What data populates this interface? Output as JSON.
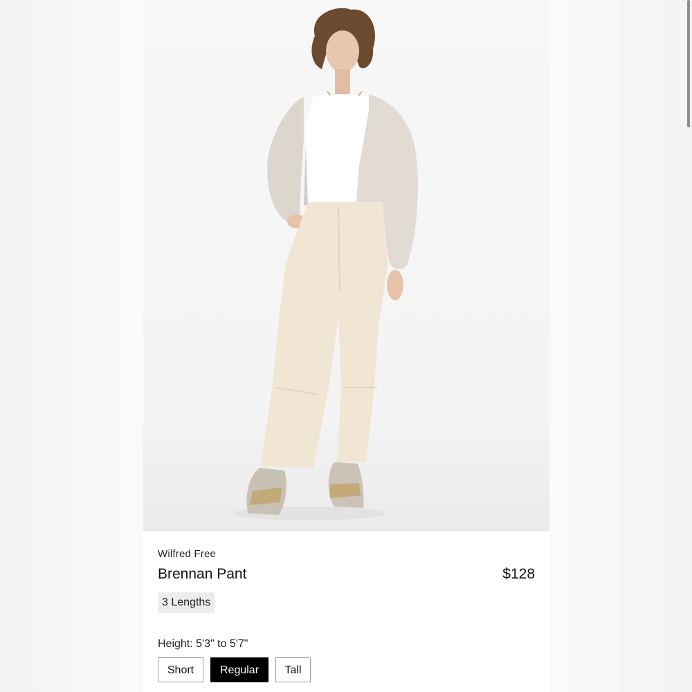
{
  "product": {
    "brand": "Wilfred Free",
    "name": "Brennan Pant",
    "price": "$128",
    "lengths_badge": "3 Lengths",
    "height_label": "Height: 5'3\" to 5'7\"",
    "length_options": [
      {
        "label": "Short",
        "selected": false
      },
      {
        "label": "Regular",
        "selected": true
      },
      {
        "label": "Tall",
        "selected": false
      }
    ]
  },
  "image": {
    "icon": "product-photo-model"
  },
  "colors": {
    "selected_bg": "#000000",
    "badge_bg": "#ececec",
    "pant_color": "#f1e6d4",
    "cardigan_color": "#dcd6cf"
  }
}
